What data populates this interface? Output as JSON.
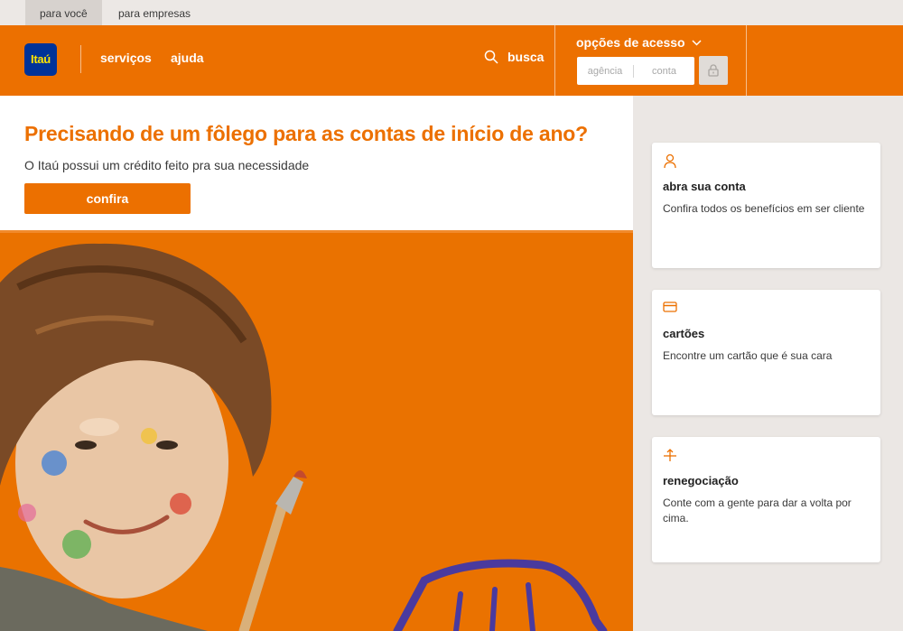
{
  "segments": [
    {
      "label": "para você",
      "active": true
    },
    {
      "label": "para empresas",
      "active": false
    }
  ],
  "header": {
    "logo_text": "Itaú",
    "nav": [
      {
        "label": "serviços"
      },
      {
        "label": "ajuda"
      }
    ],
    "search_label": "busca",
    "access": {
      "title": "opções de acesso",
      "agency_placeholder": "agência",
      "account_placeholder": "conta"
    }
  },
  "promo": {
    "title": "Precisando de um fôlego para as contas de início de ano?",
    "subtitle": "O Itaú possui um crédito feito pra sua necessidade",
    "button_label": "confira"
  },
  "cards": [
    {
      "icon": "person-icon",
      "title": "abra sua conta",
      "description": "Confira todos os benefícios em ser cliente"
    },
    {
      "icon": "credit-card-icon",
      "title": "cartões",
      "description": "Encontre um cartão que é sua cara"
    },
    {
      "icon": "renegotiation-icon",
      "title": "renegociação",
      "description": "Conte com a gente para dar a volta por cima."
    }
  ],
  "colors": {
    "brand_orange": "#ec7000",
    "logo_blue": "#003399",
    "logo_yellow": "#ffe500",
    "side_bg": "#ebe7e4"
  }
}
